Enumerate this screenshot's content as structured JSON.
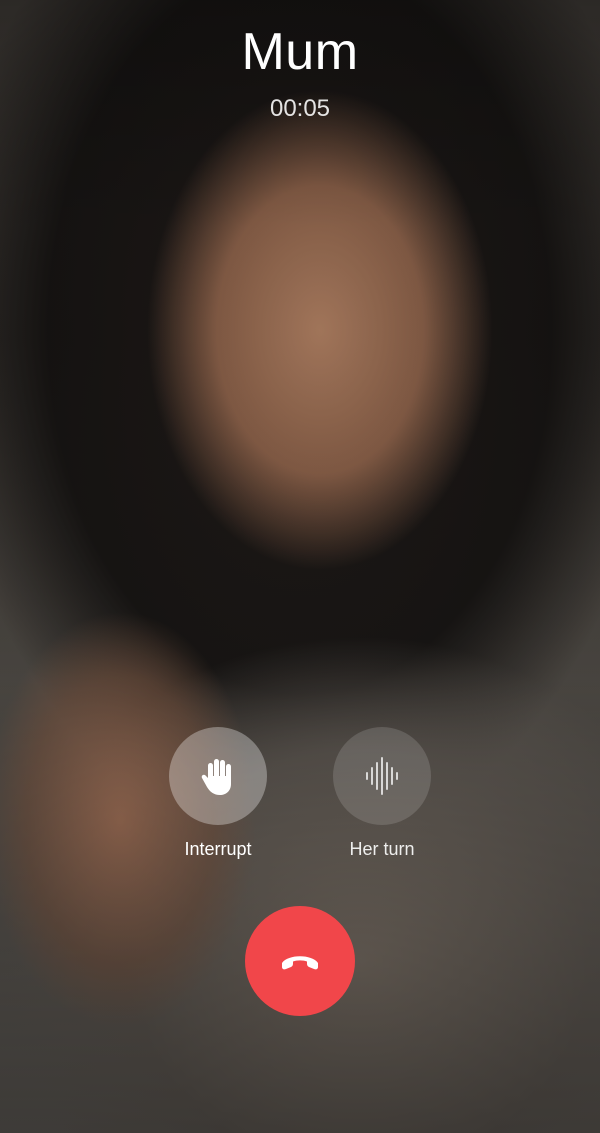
{
  "call": {
    "caller_name": "Mum",
    "duration": "00:05"
  },
  "actions": {
    "interrupt": {
      "label": "Interrupt",
      "icon": "raised-hand-icon"
    },
    "her_turn": {
      "label": "Her turn",
      "icon": "sound-wave-icon"
    }
  },
  "end_call": {
    "icon": "hang-up-phone-icon"
  },
  "colors": {
    "end_call": "#f1464a",
    "text": "#ffffff"
  }
}
